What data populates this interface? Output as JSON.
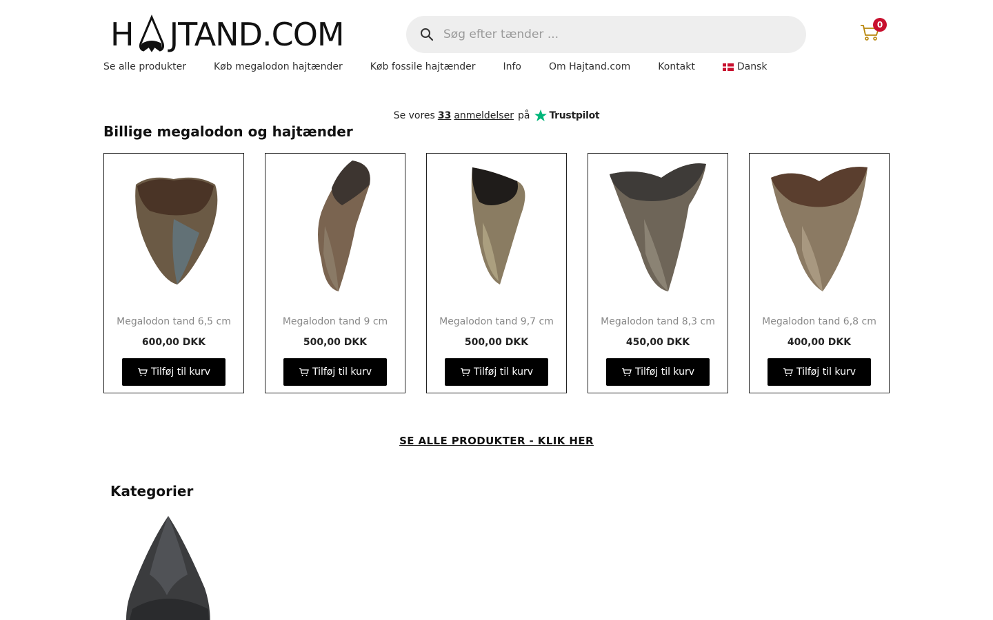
{
  "header": {
    "logo_text_left": "H",
    "logo_text_right": "JTAND.COM",
    "search_placeholder": "Søg efter tænder ...",
    "cart_count": "0"
  },
  "nav": {
    "items": [
      {
        "label": "Se alle produkter"
      },
      {
        "label": "Køb megalodon hajtænder"
      },
      {
        "label": "Køb fossile hajtænder"
      },
      {
        "label": "Info"
      },
      {
        "label": "Om Hajtand.com"
      },
      {
        "label": "Kontakt"
      },
      {
        "label": "Dansk"
      }
    ]
  },
  "trustpilot": {
    "prefix": "Se vores",
    "count": "33",
    "reviews": "anmeldelser",
    "on": "på",
    "brand": "Trustpilot"
  },
  "section_title": "Billige megalodon og hajtænder",
  "products": [
    {
      "name": "Megalodon tand 6,5 cm",
      "price": "600,00 DKK",
      "button": "Tilføj til kurv"
    },
    {
      "name": "Megalodon tand 9 cm",
      "price": "500,00 DKK",
      "button": "Tilføj til kurv"
    },
    {
      "name": "Megalodon tand 9,7 cm",
      "price": "500,00 DKK",
      "button": "Tilføj til kurv"
    },
    {
      "name": "Megalodon tand 8,3 cm",
      "price": "450,00 DKK",
      "button": "Tilføj til kurv"
    },
    {
      "name": "Megalodon tand 6,8 cm",
      "price": "400,00 DKK",
      "button": "Tilføj til kurv"
    }
  ],
  "see_all_link": "SE ALLE PRODUKTER - KLIK HER",
  "categories_title": "Kategorier",
  "colors": {
    "button_bg": "#000000",
    "badge": "#c8102e",
    "trustpilot_green": "#00b67a",
    "search_bg": "#eeeeee"
  }
}
